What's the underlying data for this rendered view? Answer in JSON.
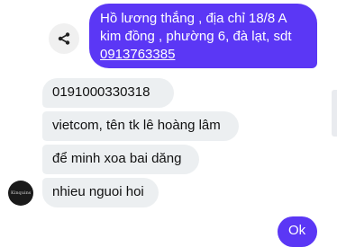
{
  "outgoing_message": {
    "line1": "Hồ lương thắng , địa chỉ 18/8 A",
    "line2": "kim đồng , phường 6, đà lạt, sdt",
    "phone_link": "0913763385"
  },
  "incoming_messages": [
    {
      "text": "0191000330318"
    },
    {
      "text": "vietcom, tên tk lê hoàng lâm"
    },
    {
      "text": "để minh xoa bai dăng"
    },
    {
      "text": "nhieu nguoi hoi"
    }
  ],
  "avatar": {
    "label": "Kinquins"
  },
  "partial_outgoing": {
    "text": "Ok"
  },
  "icons": {
    "share": "share-icon"
  },
  "colors": {
    "outgoing_bubble": "#5b37f5",
    "incoming_bubble": "#eceff1"
  }
}
